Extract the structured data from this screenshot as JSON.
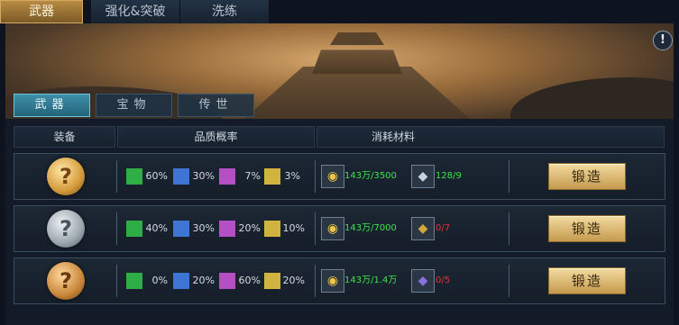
{
  "top_tabs": [
    "武器",
    "强化&突破",
    "洗练"
  ],
  "sub_tabs": [
    "武器",
    "宝物",
    "传世"
  ],
  "info_icon": "!",
  "headers": {
    "equip": "装备",
    "quality": "品质概率",
    "materials": "消耗材料"
  },
  "quality_colors": {
    "green": "#2fae45",
    "blue": "#3e74d4",
    "purple": "#b54fc5",
    "yellow": "#d1b43e"
  },
  "rows": [
    {
      "icon_style": "gold",
      "icon_glyph": "?",
      "pct": [
        "60%",
        "30%",
        "7%",
        "3%"
      ],
      "mat1_icon": "coin-icon",
      "mat1_text": "143万/3500",
      "mat2_icon": "ore-icon",
      "mat2_text": "128/9",
      "mat2_status": "enough",
      "button": "锻造"
    },
    {
      "icon_style": "silver",
      "icon_glyph": "?",
      "pct": [
        "40%",
        "30%",
        "20%",
        "10%"
      ],
      "mat1_icon": "coin-icon",
      "mat1_text": "143万/7000",
      "mat2_icon": "ore-icon",
      "mat2_text": "0/7",
      "mat2_status": "insufficient",
      "button": "锻造"
    },
    {
      "icon_style": "orange",
      "icon_glyph": "?",
      "pct": [
        "0%",
        "20%",
        "60%",
        "20%"
      ],
      "mat1_icon": "coin-icon",
      "mat1_text": "143万/1.4万",
      "mat2_icon": "ore-icon",
      "mat2_text": "0/5",
      "mat2_status": "insufficient",
      "button": "锻造"
    }
  ]
}
